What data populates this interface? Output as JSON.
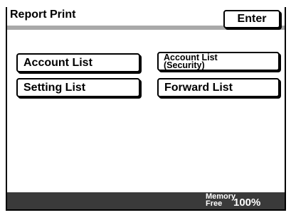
{
  "header": {
    "title": "Report Print",
    "enter_label": "Enter"
  },
  "buttons": {
    "account_list": "Account List",
    "account_list_security_line1": "Account List",
    "account_list_security_line2": "(Security)",
    "setting_list": "Setting List",
    "forward_list": "Forward List"
  },
  "status": {
    "memory_line1": "Memory",
    "memory_line2": "Free",
    "memory_value": "100%"
  },
  "colors": {
    "title_bar": "#a9a9a9",
    "status_bar": "#3a3a3a",
    "border": "#000000",
    "background": "#ffffff"
  }
}
